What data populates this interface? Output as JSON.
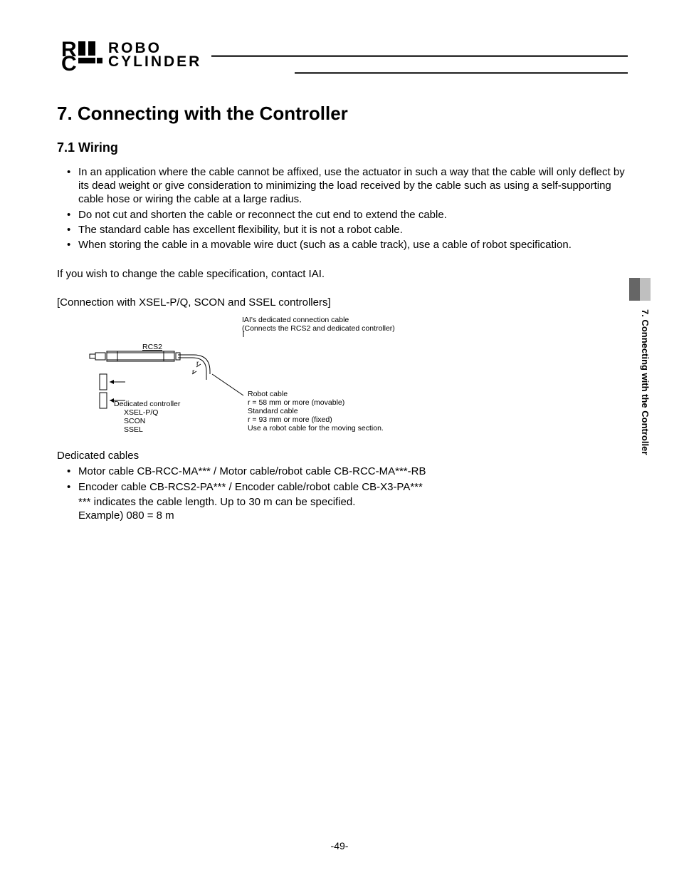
{
  "logo": {
    "line1": "ROBO",
    "line2": "CYLINDER"
  },
  "heading_main": "7.  Connecting with the Controller",
  "heading_sub": "7.1  Wiring",
  "bullets": [
    "In an application where the cable cannot be affixed, use the actuator in such a way that the cable will only deflect by its dead weight or give consideration to minimizing the load received by the cable such as using a self-supporting cable hose or wiring the cable at a large radius.",
    "Do not cut and shorten the cable or reconnect the cut end to extend the cable.",
    "The standard cable has excellent flexibility, but it is not a robot cable.",
    "When storing the cable in a movable wire duct (such as a cable track), use a cable of robot specification."
  ],
  "para_change": "If you wish to change the cable specification, contact IAI.",
  "bracket_header": "[Connection with XSEL-P/Q, SCON and SSEL controllers]",
  "diagram": {
    "top_label1": "IAI's dedicated connection cable",
    "top_label2": "(Connects the RCS2 and dedicated controller)",
    "rcs2": "RCS2",
    "controller_hdr": "Dedicated controller",
    "controller1": "XSEL-P/Q",
    "controller2": "SCON",
    "controller3": "SSEL",
    "cable_hdr": "Robot cable",
    "cable_r1": "r = 58 mm or more (movable)",
    "cable_std": "Standard cable",
    "cable_r2": "r = 93 mm or more (fixed)",
    "cable_note": "Use a robot cable for the moving section."
  },
  "dedicated_cables_hdr": "Dedicated cables",
  "cable_bullets": [
    "Motor cable CB-RCC-MA*** / Motor cable/robot cable CB-RCC-MA***-RB",
    "Encoder cable CB-RCS2-PA*** / Encoder cable/robot cable CB-X3-PA***"
  ],
  "cable_sub1": "*** indicates the cable length. Up to 30 m can be specified.",
  "cable_sub2": "Example) 080 = 8 m",
  "page_number": "-49-",
  "side_label": "7. Connecting with the Controller"
}
